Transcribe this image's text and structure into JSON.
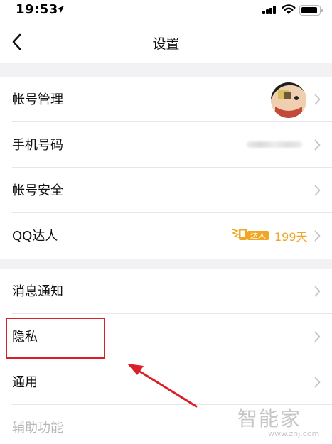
{
  "status_bar": {
    "time": "19:53"
  },
  "nav": {
    "title": "设置",
    "back_icon": "chevron-left-icon"
  },
  "settings": {
    "account_management": {
      "label": "帐号管理"
    },
    "phone_number": {
      "label": "手机号码"
    },
    "account_security": {
      "label": "帐号安全"
    },
    "qq_expert": {
      "label": "QQ达人",
      "badge_text": "达人",
      "days": "199天",
      "badge_color": "#f1a624"
    },
    "notifications": {
      "label": "消息通知"
    },
    "privacy": {
      "label": "隐私"
    },
    "general": {
      "label": "通用"
    },
    "accessibility": {
      "label": "辅助功能"
    }
  },
  "annotation": {
    "color": "#d9202a"
  },
  "watermark": {
    "text": "智能家",
    "url": "www.znj.com"
  }
}
